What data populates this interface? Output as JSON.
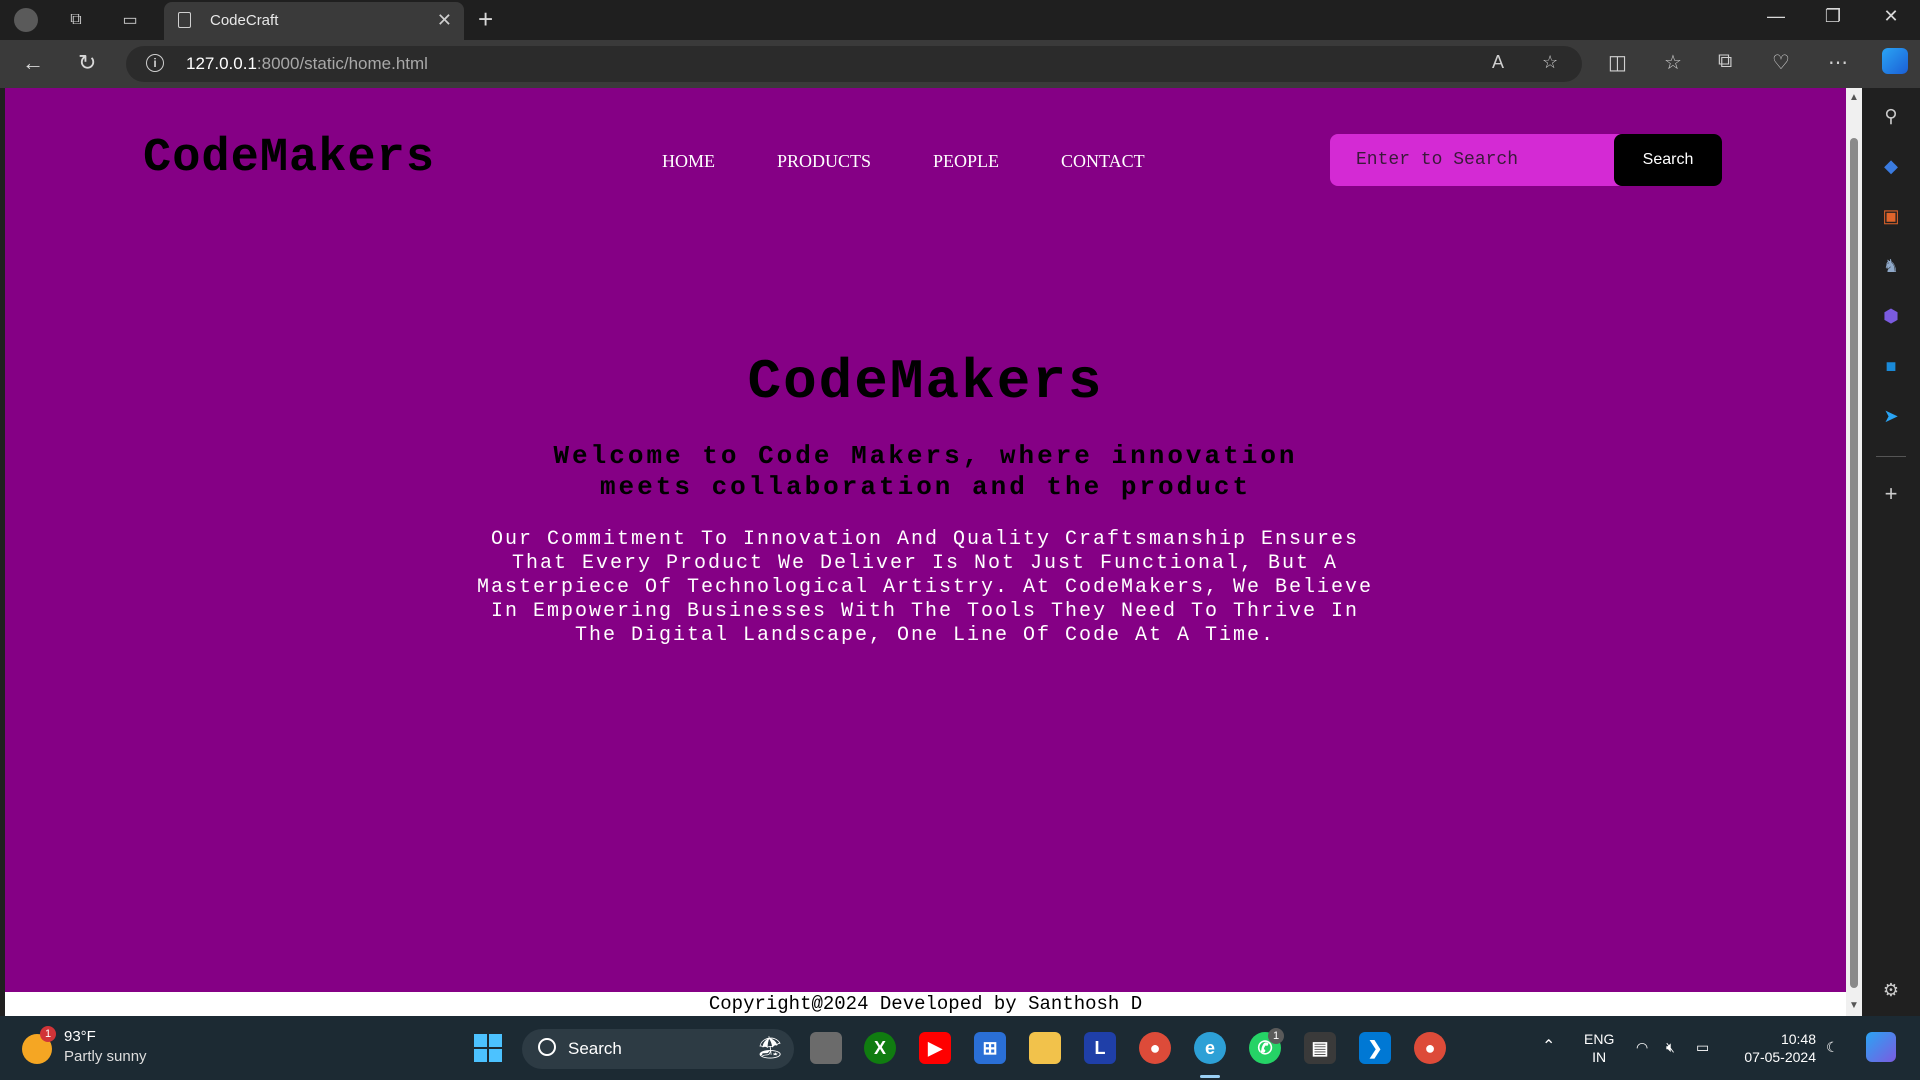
{
  "browser": {
    "tab_title": "CodeCraft",
    "url_host": "127.0.0.1",
    "url_path": ":8000/static/home.html"
  },
  "page": {
    "logo": "CodeMakers",
    "nav": [
      "HOME",
      "PRODUCTS",
      "PEOPLE",
      "CONTACT"
    ],
    "search_placeholder": "Enter to Search",
    "search_button": "Search",
    "hero_title": "CodeMakers",
    "hero_subtitle": "Welcome to Code Makers, where innovation meets collaboration and the product",
    "hero_text": "Our Commitment To Innovation And Quality Craftsmanship Ensures That Every Product We Deliver Is Not Just Functional, But A Masterpiece Of Technological Artistry. At CodeMakers, We Believe In Empowering Businesses With The Tools They Need To Thrive In The Digital Landscape, One Line Of Code At A Time.",
    "footer": "Copyright@2024 Developed by Santhosh D"
  },
  "taskbar": {
    "weather_temp": "93°F",
    "weather_desc": "Partly sunny",
    "weather_badge": "1",
    "search_label": "Search",
    "lang_top": "ENG",
    "lang_bottom": "IN",
    "time": "10:48",
    "date": "07-05-2024",
    "whatsapp_badge": "1"
  },
  "colors": {
    "page_bg": "#850085",
    "search_bg": "#d42ad4",
    "button_bg": "#000000"
  }
}
